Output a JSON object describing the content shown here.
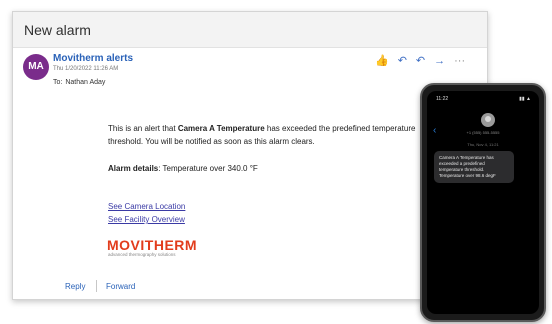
{
  "window": {
    "title": "New alarm"
  },
  "email": {
    "avatar_initials": "MA",
    "sender": "Movitherm alerts",
    "sent_time": "Thu 1/20/2022 11:26 AM",
    "to_label": "To:",
    "to_name": "Nathan Aday",
    "body_part1": "This is an alert that ",
    "body_bold": "Camera A Temperature",
    "body_part2": " has exceeded the predefined temperature threshold. You will be notified as soon as this alarm clears.",
    "details_label": "Alarm details",
    "details_value": ": Temperature over 340.0 °F",
    "link_camera": "See Camera Location",
    "link_facility": "See Facility Overview",
    "logo_text": "MOVITHERM",
    "logo_tagline": "advanced thermography solutions",
    "reply_label": "Reply",
    "forward_label": "Forward",
    "actions": [
      {
        "name": "like-icon",
        "glyph": "👍"
      },
      {
        "name": "reply-icon",
        "glyph": "↶"
      },
      {
        "name": "reply-all-icon",
        "glyph": "↶"
      },
      {
        "name": "forward-icon",
        "glyph": "→"
      },
      {
        "name": "more-icon",
        "glyph": "···"
      }
    ]
  },
  "phone": {
    "time": "11:22",
    "status": "▮▮ ▲",
    "back_glyph": "‹",
    "contact": "+1 (555) 555-5555",
    "date": "Thu, Nov 4, 11:21",
    "message": "Camera A Temperature has exceeded a predefined temperature threshold. Temperature over 98.6 degF"
  },
  "colors": {
    "accent": "#2a62b8",
    "avatar": "#7a2c8b",
    "logo": "#e23c1c",
    "link": "#3a3aa5"
  }
}
